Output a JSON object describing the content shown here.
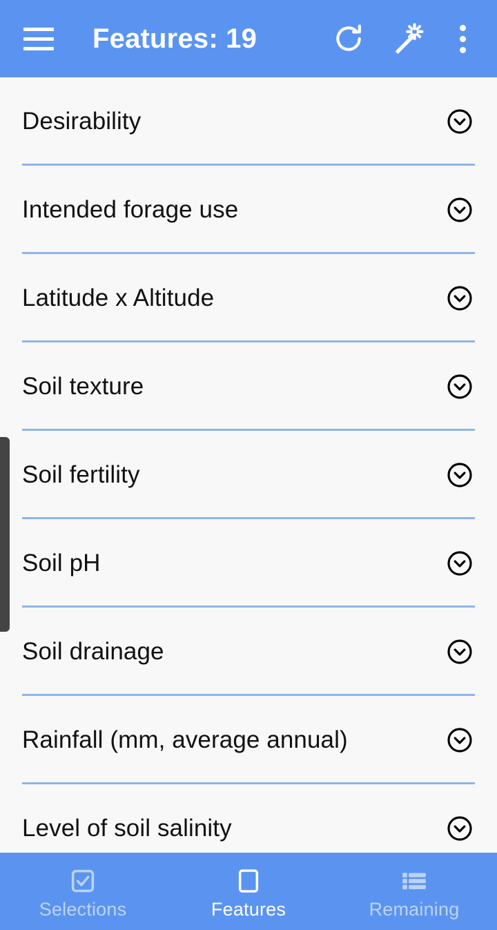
{
  "appbar": {
    "menu_icon": "hamburger-menu-icon",
    "title": "Features: 19",
    "refresh_icon": "refresh-icon",
    "wand_icon": "magic-wand-icon",
    "overflow_icon": "overflow-menu-icon",
    "background_color": "#5b94f0",
    "text_color": "#ffffff"
  },
  "list": {
    "row_icon": "chevron-down-circle-icon",
    "divider_color": "#8cb6e8",
    "background_color": "#f8f8f8",
    "rows": [
      {
        "label": "Desirability"
      },
      {
        "label": "Intended forage use"
      },
      {
        "label": "Latitude x Altitude"
      },
      {
        "label": "Soil texture"
      },
      {
        "label": "Soil fertility"
      },
      {
        "label": "Soil pH"
      },
      {
        "label": "Soil drainage"
      },
      {
        "label": "Rainfall (mm, average annual)"
      },
      {
        "label": "Level of soil salinity"
      }
    ]
  },
  "scrollbar": {
    "name": "vertical-scrollbar-thumb",
    "color": "#444444"
  },
  "bottomnav": {
    "background_color": "#5b94f0",
    "active_color": "#ffffff",
    "inactive_color": "#bcd3f7",
    "items": [
      {
        "label": "Selections",
        "icon": "checkbox-checked-icon",
        "active": false
      },
      {
        "label": "Features",
        "icon": "checkbox-empty-icon",
        "active": true
      },
      {
        "label": "Remaining",
        "icon": "list-bullet-icon",
        "active": false
      }
    ]
  }
}
